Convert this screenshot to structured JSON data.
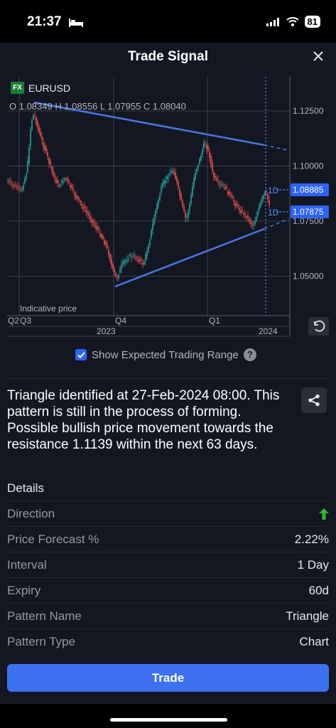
{
  "status_bar": {
    "time": "21:37",
    "battery": "81"
  },
  "header": {
    "title": "Trade Signal"
  },
  "chart_header": {
    "fx_badge": "FX",
    "symbol": "EURUSD",
    "ohlc": "O 1.08349   H 1.08556   L 1.07955   C 1.08040"
  },
  "chart_data": {
    "type": "line",
    "y_axis": {
      "ticks": [
        "1.12500",
        "1.10000",
        "1.07500",
        "1.05000"
      ]
    },
    "x_axis": {
      "quarters": [
        "Q2",
        "Q3",
        "Q4",
        "Q1"
      ],
      "years": [
        "2023",
        "2024"
      ]
    },
    "note": "Indicative price",
    "badges": [
      {
        "period": "1D",
        "value": "1.08885"
      },
      {
        "period": "1D",
        "value": "1.07875"
      }
    ]
  },
  "options": {
    "expected_range_label": "Show Expected Trading Range",
    "checked": true
  },
  "description": "Triangle identified at 27-Feb-2024 08:00. This pattern is still in the process of forming. Possible bullish price movement towards the resistance 1.1139 within the next 63 days.",
  "details": {
    "title": "Details",
    "rows": [
      {
        "label": "Direction",
        "value": ""
      },
      {
        "label": "Price Forecast %",
        "value": "2.22%"
      },
      {
        "label": "Interval",
        "value": "1 Day"
      },
      {
        "label": "Expiry",
        "value": "60d"
      },
      {
        "label": "Pattern Name",
        "value": "Triangle"
      },
      {
        "label": "Pattern Type",
        "value": "Chart"
      }
    ]
  },
  "trade_button": "Trade",
  "colors": {
    "bull": "#26a69a",
    "bear": "#ef5350",
    "accent": "#3d71f0",
    "green_up": "#2eb82e"
  }
}
